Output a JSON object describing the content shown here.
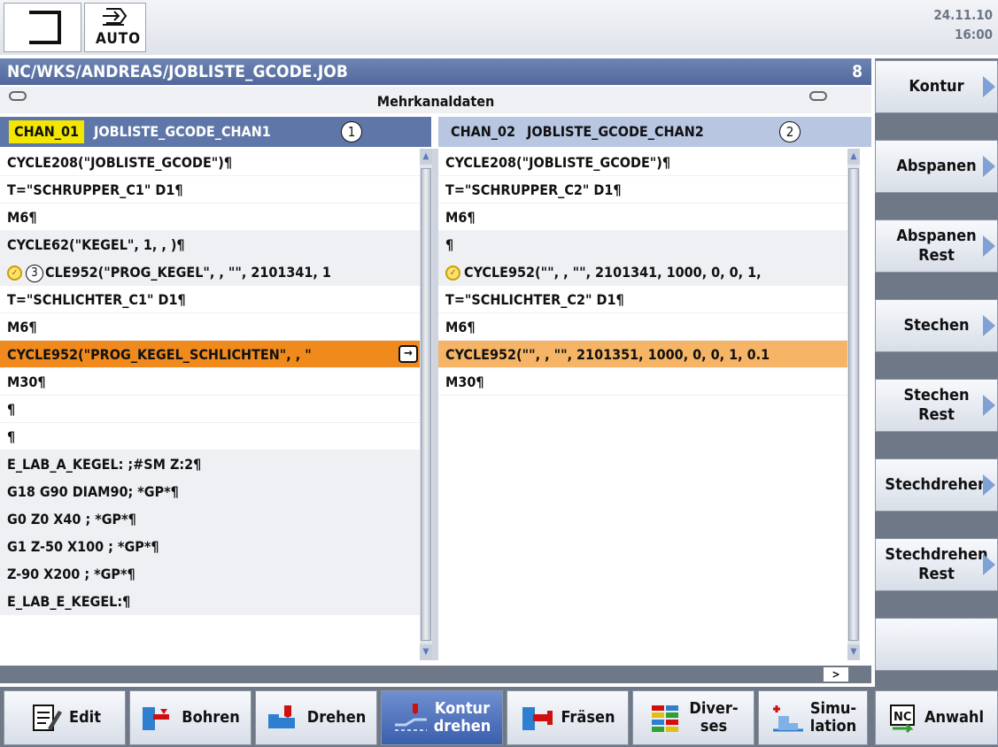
{
  "header": {
    "mode_label": "AUTO",
    "date": "24.11.10",
    "time": "16:00"
  },
  "path_bar": {
    "path": "NC/WKS/ANDREAS/JOBLISTE_GCODE.JOB",
    "count": "8"
  },
  "multichannel": {
    "title": "Mehrkanaldaten"
  },
  "channel1": {
    "code": "CHAN_01",
    "name": "JOBLISTE_GCODE_CHAN1",
    "marker": "1",
    "lines": [
      "CYCLE208(\"JOBLISTE_GCODE\")¶",
      "T=\"SCHRUPPER_C1\" D1¶",
      "M6¶",
      "CYCLE62(\"KEGEL\", 1, , )¶",
      "CLE952(\"PROG_KEGEL\", , \"\", 2101341, 1",
      "T=\"SCHLICHTER_C1\" D1¶",
      "M6¶",
      "CYCLE952(\"PROG_KEGEL_SCHLICHTEN\", , \"",
      "M30¶",
      "¶",
      "¶",
      "E_LAB_A_KEGEL: ;#SM Z:2¶",
      "G18 G90 DIAM90; *GP*¶",
      "G0 Z0 X40 ; *GP*¶",
      "G1 Z-50 X100 ; *GP*¶",
      "Z-90 X200 ; *GP*¶",
      "E_LAB_E_KEGEL:¶"
    ],
    "line_marker": "3"
  },
  "channel2": {
    "code": "CHAN_02",
    "name": "JOBLISTE_GCODE_CHAN2",
    "marker": "2",
    "lines": [
      "CYCLE208(\"JOBLISTE_GCODE\")¶",
      "T=\"SCHRUPPER_C2\" D1¶",
      "M6¶",
      "¶",
      "CYCLE952(\"\", , \"\", 2101341, 1000, 0, 0, 1,",
      "T=\"SCHLICHTER_C2\" D1¶",
      "M6¶",
      "CYCLE952(\"\", , \"\", 2101351, 1000, 0, 0, 1, 0.1",
      "M30¶"
    ]
  },
  "more_indicator": ">",
  "right_softkeys": [
    {
      "label": "Kontur"
    },
    {
      "label": "Abspanen"
    },
    {
      "label": "Abspanen\nRest"
    },
    {
      "label": "Stechen"
    },
    {
      "label": "Stechen\nRest"
    },
    {
      "label": "Stechdrehen"
    },
    {
      "label": "Stechdrehen\nRest"
    },
    {
      "label": ""
    }
  ],
  "bottom_softkeys": [
    {
      "label": "Edit"
    },
    {
      "label": "Bohren"
    },
    {
      "label": "Drehen"
    },
    {
      "label": "Kontur\ndrehen"
    },
    {
      "label": "Fräsen"
    },
    {
      "label": "Diver-\nses"
    },
    {
      "label": "Simu-\nlation"
    },
    {
      "label": "Anwahl",
      "icon_text": "NC"
    }
  ],
  "colors": {
    "path_bar": "#5a70a3",
    "channel1_header": "#5f77a8",
    "channel2_header": "#b8c6e2",
    "highlight_active": "#f08a1d",
    "highlight_channel2": "#f6b566",
    "softkey_arrow": "#7ea1d6"
  }
}
